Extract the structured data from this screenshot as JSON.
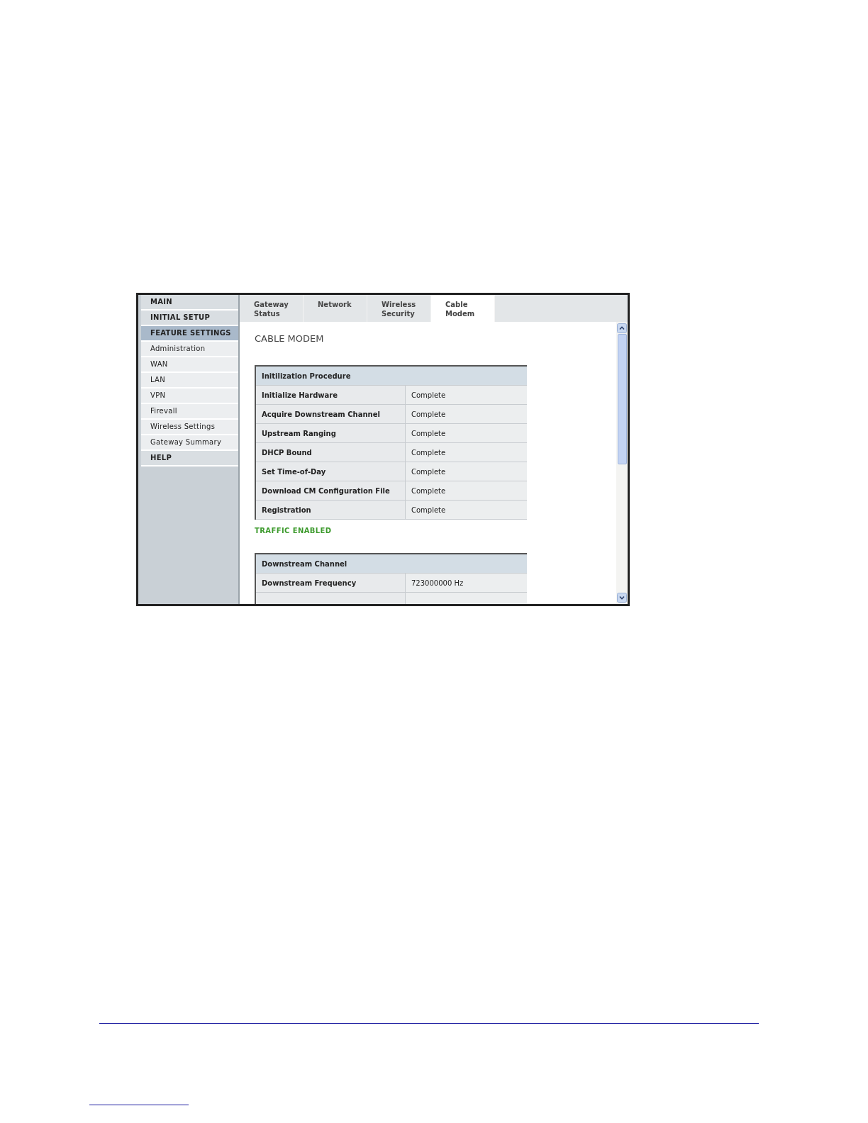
{
  "sidebar": {
    "items": [
      {
        "label": "MAIN",
        "kind": "section",
        "selected": false
      },
      {
        "label": "INITIAL SETUP",
        "kind": "section",
        "selected": false
      },
      {
        "label": "FEATURE SETTINGS",
        "kind": "section",
        "selected": true
      },
      {
        "label": "Administration",
        "kind": "link",
        "selected": false
      },
      {
        "label": "WAN",
        "kind": "link",
        "selected": false
      },
      {
        "label": "LAN",
        "kind": "link",
        "selected": false
      },
      {
        "label": "VPN",
        "kind": "link",
        "selected": false
      },
      {
        "label": "Firevall",
        "kind": "link",
        "selected": false
      },
      {
        "label": "Wireless Settings",
        "kind": "link",
        "selected": false
      },
      {
        "label": "Gateway Summary",
        "kind": "link",
        "selected": false
      },
      {
        "label": "HELP",
        "kind": "section",
        "selected": false
      }
    ]
  },
  "tabs": [
    {
      "lines": [
        "Gateway",
        "Status"
      ],
      "selected": false
    },
    {
      "lines": [
        "Network"
      ],
      "selected": false
    },
    {
      "lines": [
        "Wireless",
        "Security"
      ],
      "selected": false
    },
    {
      "lines": [
        "Cable",
        "Modem"
      ],
      "selected": true
    }
  ],
  "page_title": "CABLE MODEM",
  "init_table": {
    "heading": "Initilization Procedure",
    "rows": [
      {
        "step": "Initialize Hardware",
        "status": "Complete"
      },
      {
        "step": "Acquire Downstream Channel",
        "status": "Complete"
      },
      {
        "step": "Upstream Ranging",
        "status": "Complete"
      },
      {
        "step": "DHCP Bound",
        "status": "Complete"
      },
      {
        "step": "Set Time-of-Day",
        "status": "Complete"
      },
      {
        "step": "Download CM Configuration File",
        "status": "Complete"
      },
      {
        "step": "Registration",
        "status": "Complete"
      }
    ]
  },
  "traffic_status": "TRAFFIC ENABLED",
  "downstream_table": {
    "heading": "Downstream Channel",
    "rows": [
      {
        "step": "Downstream Frequency",
        "status": "723000000 Hz"
      }
    ]
  }
}
